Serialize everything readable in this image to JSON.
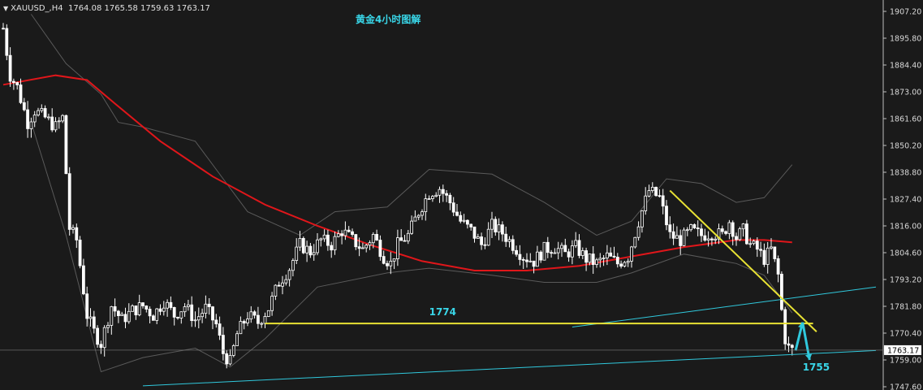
{
  "header": {
    "symbol": "XAUUSD_,H4",
    "ohlc": "1764.08 1765.58 1759.63 1763.17"
  },
  "title": "黄金4小时图解",
  "colors": {
    "background": "#1a1a1a",
    "candle": "#ffffff",
    "ma": "#e0161a",
    "band": "#5a5a5a",
    "support": "#e8e234",
    "channel": "#30c8dc",
    "arrow": "#30c8dc",
    "label": "#39d6e8",
    "price_tag": "#ffffff"
  },
  "chart_data": {
    "type": "candlestick",
    "symbol": "XAUUSD",
    "timeframe": "H4",
    "ylim": [
      1745,
      1910
    ],
    "y_ticks": [
      "1907.20",
      "1895.80",
      "1884.40",
      "1873.00",
      "1861.60",
      "1850.20",
      "1838.80",
      "1827.40",
      "1816.00",
      "1804.60",
      "1793.20",
      "1781.80",
      "1770.40",
      "1759.00",
      "1747.60"
    ],
    "last_price": "1763.17",
    "path_points": [
      [
        0,
        1900
      ],
      [
        2,
        1880
      ],
      [
        4,
        1875
      ],
      [
        7,
        1860
      ],
      [
        9,
        1865
      ],
      [
        12,
        1862
      ],
      [
        15,
        1858
      ],
      [
        17,
        1862
      ],
      [
        19,
        1815
      ],
      [
        21,
        1810
      ],
      [
        24,
        1778
      ],
      [
        26,
        1771
      ],
      [
        28,
        1766
      ],
      [
        31,
        1782
      ],
      [
        34,
        1776
      ],
      [
        37,
        1780
      ],
      [
        40,
        1782
      ],
      [
        43,
        1778
      ],
      [
        46,
        1784
      ],
      [
        49,
        1778
      ],
      [
        52,
        1782
      ],
      [
        55,
        1776
      ],
      [
        58,
        1781
      ],
      [
        61,
        1774
      ],
      [
        63,
        1762
      ],
      [
        65,
        1758
      ],
      [
        67,
        1770
      ],
      [
        70,
        1778
      ],
      [
        73,
        1775
      ],
      [
        76,
        1781
      ],
      [
        79,
        1792
      ],
      [
        82,
        1798
      ],
      [
        85,
        1808
      ],
      [
        88,
        1805
      ],
      [
        91,
        1810
      ],
      [
        94,
        1808
      ],
      [
        97,
        1814
      ],
      [
        100,
        1810
      ],
      [
        103,
        1806
      ],
      [
        106,
        1812
      ],
      [
        109,
        1803
      ],
      [
        111,
        1800
      ],
      [
        113,
        1808
      ],
      [
        116,
        1812
      ],
      [
        119,
        1822
      ],
      [
        122,
        1830
      ],
      [
        125,
        1832
      ],
      [
        128,
        1826
      ],
      [
        131,
        1818
      ],
      [
        134,
        1814
      ],
      [
        137,
        1808
      ],
      [
        140,
        1816
      ],
      [
        143,
        1813
      ],
      [
        146,
        1808
      ],
      [
        149,
        1803
      ],
      [
        152,
        1801
      ],
      [
        155,
        1806
      ],
      [
        158,
        1807
      ],
      [
        161,
        1804
      ],
      [
        164,
        1807
      ],
      [
        167,
        1802
      ],
      [
        170,
        1800
      ],
      [
        173,
        1803
      ],
      [
        176,
        1800
      ],
      [
        179,
        1803
      ],
      [
        182,
        1818
      ],
      [
        185,
        1831
      ],
      [
        188,
        1828
      ],
      [
        191,
        1812
      ],
      [
        194,
        1810
      ],
      [
        197,
        1814
      ],
      [
        200,
        1812
      ],
      [
        203,
        1813
      ],
      [
        206,
        1812
      ],
      [
        208,
        1818
      ],
      [
        210,
        1811
      ],
      [
        212,
        1814
      ],
      [
        214,
        1808
      ],
      [
        216,
        1806
      ],
      [
        218,
        1802
      ],
      [
        220,
        1806
      ],
      [
        222,
        1795
      ],
      [
        223,
        1780
      ],
      [
        224,
        1768
      ],
      [
        225,
        1764
      ],
      [
        226,
        1763.17
      ]
    ],
    "moving_average": {
      "name": "",
      "values": [
        [
          0,
          1876
        ],
        [
          15,
          1880
        ],
        [
          24,
          1878
        ],
        [
          32,
          1868
        ],
        [
          45,
          1852
        ],
        [
          60,
          1837
        ],
        [
          75,
          1825
        ],
        [
          90,
          1816
        ],
        [
          105,
          1808
        ],
        [
          120,
          1801
        ],
        [
          135,
          1797
        ],
        [
          150,
          1797
        ],
        [
          165,
          1799
        ],
        [
          180,
          1803
        ],
        [
          195,
          1807
        ],
        [
          210,
          1810
        ],
        [
          218,
          1810
        ],
        [
          226,
          1809
        ]
      ]
    },
    "bands": {
      "upper": [
        [
          8,
          1906
        ],
        [
          18,
          1885
        ],
        [
          28,
          1872
        ],
        [
          33,
          1860
        ],
        [
          40,
          1858
        ],
        [
          55,
          1852
        ],
        [
          70,
          1822
        ],
        [
          85,
          1812
        ],
        [
          95,
          1822
        ],
        [
          110,
          1824
        ],
        [
          122,
          1840
        ],
        [
          140,
          1838
        ],
        [
          155,
          1826
        ],
        [
          170,
          1812
        ],
        [
          180,
          1818
        ],
        [
          190,
          1836
        ],
        [
          200,
          1834
        ],
        [
          210,
          1826
        ],
        [
          218,
          1828
        ],
        [
          226,
          1842
        ]
      ],
      "lower": [
        [
          8,
          1860
        ],
        [
          18,
          1812
        ],
        [
          28,
          1754
        ],
        [
          40,
          1760
        ],
        [
          55,
          1764
        ],
        [
          65,
          1756
        ],
        [
          75,
          1768
        ],
        [
          90,
          1790
        ],
        [
          110,
          1796
        ],
        [
          122,
          1798
        ],
        [
          140,
          1795
        ],
        [
          155,
          1792
        ],
        [
          170,
          1792
        ],
        [
          180,
          1796
        ],
        [
          195,
          1804
        ],
        [
          210,
          1800
        ],
        [
          218,
          1795
        ],
        [
          226,
          1779
        ]
      ]
    },
    "annotations": {
      "support_level": 1774,
      "support_label": "1774",
      "target_label": "1755",
      "support_line": {
        "from": [
          75,
          1774.5
        ],
        "to": [
          232,
          1774.5
        ]
      },
      "trendline": {
        "from": [
          191,
          1831
        ],
        "to": [
          233,
          1771
        ]
      },
      "channel_lower": {
        "from": [
          40,
          1748
        ],
        "to": [
          250,
          1763
        ]
      },
      "channel_upper": {
        "from": [
          163,
          1773
        ],
        "to": [
          250,
          1790
        ]
      },
      "arrow_up": {
        "from": [
          227,
          1763
        ],
        "to": [
          229,
          1775
        ]
      },
      "arrow_down": {
        "from": [
          229,
          1775
        ],
        "to": [
          231,
          1759
        ]
      }
    }
  }
}
